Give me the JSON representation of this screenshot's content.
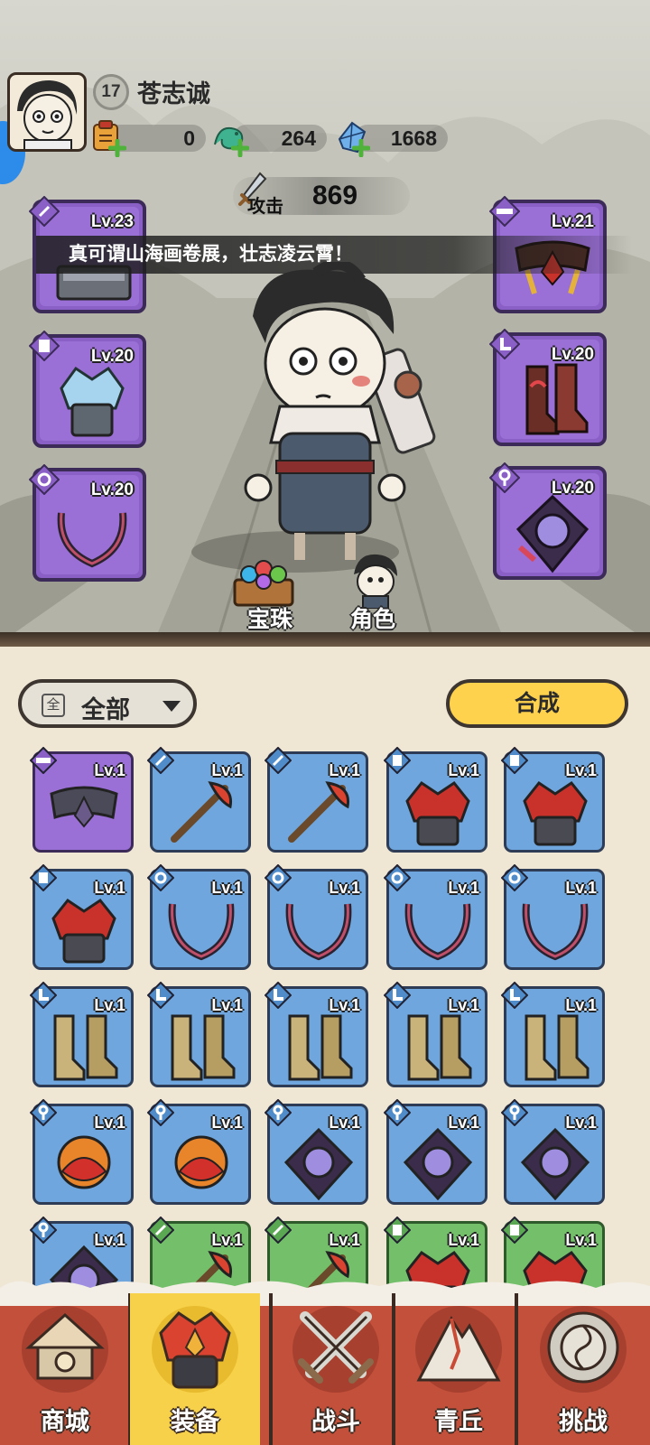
{
  "player": {
    "name": "苍志诚",
    "level": "17"
  },
  "resources": [
    {
      "icon": "scroll-bag-icon",
      "value": "0"
    },
    {
      "icon": "jade-dragon-icon",
      "value": "264"
    },
    {
      "icon": "crystal-icon",
      "value": "1668"
    }
  ],
  "attack": {
    "label": "攻击",
    "value": "869"
  },
  "quote": "真可谓山海画卷展，壮志凌云霄！",
  "equipped": {
    "left": [
      {
        "slot": "weapon",
        "icon": "sword-tag-icon",
        "level": "Lv.23",
        "art": "hammer-icon"
      },
      {
        "slot": "armor",
        "icon": "armor-tag-icon",
        "level": "Lv.20",
        "art": "ice-armor-icon"
      },
      {
        "slot": "necklace",
        "icon": "ring-tag-icon",
        "level": "Lv.20",
        "art": "dark-necklace-icon"
      }
    ],
    "right": [
      {
        "slot": "belt",
        "icon": "belt-tag-icon",
        "level": "Lv.21",
        "art": "red-belt-icon"
      },
      {
        "slot": "boots",
        "icon": "boot-tag-icon",
        "level": "Lv.20",
        "art": "red-boots-icon"
      },
      {
        "slot": "accessory",
        "icon": "pendant-tag-icon",
        "level": "Lv.20",
        "art": "orb-pendant-icon"
      }
    ]
  },
  "hero_buttons": {
    "orbs": "宝珠",
    "character": "角色"
  },
  "filter": {
    "icon_text": "全",
    "label": "全部"
  },
  "synthesize_label": "合成",
  "inventory": [
    {
      "rarity": "purple",
      "level": "Lv.1",
      "tag": "belt-tag-icon",
      "art": "dark-belt-icon"
    },
    {
      "rarity": "blue",
      "level": "Lv.1",
      "tag": "sword-tag-icon",
      "art": "flame-whip-icon"
    },
    {
      "rarity": "blue",
      "level": "Lv.1",
      "tag": "sword-tag-icon",
      "art": "golden-staff-icon"
    },
    {
      "rarity": "blue",
      "level": "Lv.1",
      "tag": "armor-tag-icon",
      "art": "red-armor-icon"
    },
    {
      "rarity": "blue",
      "level": "Lv.1",
      "tag": "armor-tag-icon",
      "art": "red-armor-icon"
    },
    {
      "rarity": "blue",
      "level": "Lv.1",
      "tag": "armor-tag-icon",
      "art": "dark-armor-icon"
    },
    {
      "rarity": "blue",
      "level": "Lv.1",
      "tag": "ring-tag-icon",
      "art": "red-necklace-icon"
    },
    {
      "rarity": "blue",
      "level": "Lv.1",
      "tag": "ring-tag-icon",
      "art": "steel-necklace-icon"
    },
    {
      "rarity": "blue",
      "level": "Lv.1",
      "tag": "ring-tag-icon",
      "art": "dark-necklace-icon"
    },
    {
      "rarity": "blue",
      "level": "Lv.1",
      "tag": "ring-tag-icon",
      "art": "bone-necklace-icon"
    },
    {
      "rarity": "blue",
      "level": "Lv.1",
      "tag": "boot-tag-icon",
      "art": "frost-boots-icon"
    },
    {
      "rarity": "blue",
      "level": "Lv.1",
      "tag": "boot-tag-icon",
      "art": "frost-boots-icon"
    },
    {
      "rarity": "blue",
      "level": "Lv.1",
      "tag": "boot-tag-icon",
      "art": "purple-boots-icon"
    },
    {
      "rarity": "blue",
      "level": "Lv.1",
      "tag": "boot-tag-icon",
      "art": "gold-boots-icon"
    },
    {
      "rarity": "blue",
      "level": "Lv.1",
      "tag": "boot-tag-icon",
      "art": "gold-boots-icon"
    },
    {
      "rarity": "blue",
      "level": "Lv.1",
      "tag": "pendant-tag-icon",
      "art": "fire-orb-icon"
    },
    {
      "rarity": "blue",
      "level": "Lv.1",
      "tag": "pendant-tag-icon",
      "art": "fire-orb-icon"
    },
    {
      "rarity": "blue",
      "level": "Lv.1",
      "tag": "pendant-tag-icon",
      "art": "crystal-pendant-icon"
    },
    {
      "rarity": "blue",
      "level": "Lv.1",
      "tag": "pendant-tag-icon",
      "art": "orb-pendant-icon"
    },
    {
      "rarity": "blue",
      "level": "Lv.1",
      "tag": "pendant-tag-icon",
      "art": "orb-pendant-icon"
    },
    {
      "rarity": "blue",
      "level": "Lv.1",
      "tag": "pendant-tag-icon",
      "art": "hook-pendant-icon"
    },
    {
      "rarity": "green",
      "level": "Lv.1",
      "tag": "sword-tag-icon",
      "art": "bow-icon"
    },
    {
      "rarity": "green",
      "level": "Lv.1",
      "tag": "sword-tag-icon",
      "art": "red-whip-icon"
    },
    {
      "rarity": "green",
      "level": "Lv.1",
      "tag": "armor-tag-icon",
      "art": "red-armor-icon"
    },
    {
      "rarity": "green",
      "level": "Lv.1",
      "tag": "armor-tag-icon",
      "art": "red-armor-icon"
    }
  ],
  "nav": [
    {
      "label": "商城",
      "icon": "shop-icon",
      "active": false
    },
    {
      "label": "装备",
      "icon": "equipment-helmet-icon",
      "active": true
    },
    {
      "label": "战斗",
      "icon": "crossed-swords-icon",
      "active": false
    },
    {
      "label": "青丘",
      "icon": "mountain-icon",
      "active": false
    },
    {
      "label": "挑战",
      "icon": "challenge-orb-icon",
      "active": false
    }
  ],
  "colors": {
    "rarity_purple": "#9a6fd6",
    "rarity_blue": "#6ea6dd",
    "rarity_green": "#74c06a",
    "synth_button": "#ffd24d",
    "nav_bg": "#c2503a",
    "nav_active": "#f7d149"
  }
}
